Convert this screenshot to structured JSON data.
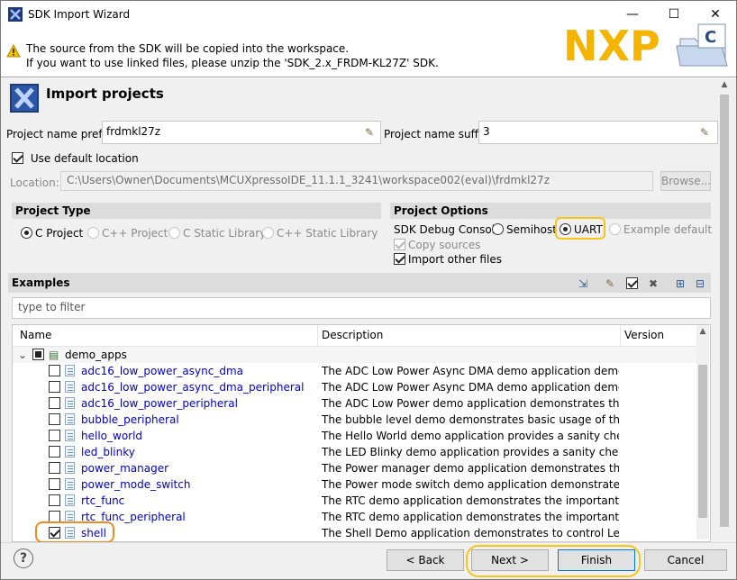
{
  "window": {
    "title": "SDK Import Wizard",
    "min_glyph": "—",
    "max_glyph": "☐",
    "close_glyph": "✕"
  },
  "banner": {
    "line1": "The source from the SDK will be copied into the workspace.",
    "line2": "If you want to use linked files, please unzip the 'SDK_2.x_FRDM-KL27Z' SDK.",
    "logo_text": "NXP",
    "folder_badge": "C"
  },
  "header": {
    "title": "Import projects"
  },
  "project": {
    "prefix_label": "Project name prefix:",
    "prefix_value": "frdmkl27z",
    "suffix_label": "Project name suffix:",
    "suffix_value": "3",
    "use_default_location_label": "Use default location",
    "use_default_location": true,
    "location_label": "Location:",
    "location_value": "C:\\Users\\Owner\\Documents\\MCUXpressoIDE_11.1.1_3241\\workspace002(eval)\\frdmkl27z",
    "browse_label": "Browse..."
  },
  "project_type": {
    "heading": "Project Type",
    "options": [
      "C Project",
      "C++ Project",
      "C Static Library",
      "C++ Static Library"
    ],
    "selected": "C Project"
  },
  "project_options": {
    "heading": "Project Options",
    "debug_console_label": "SDK Debug Console",
    "debug_options": [
      "Semihost",
      "UART",
      "Example default"
    ],
    "selected": "UART",
    "copy_sources_label": "Copy sources",
    "copy_sources": true,
    "import_other_files_label": "Import other files",
    "import_other_files": true
  },
  "examples": {
    "heading": "Examples",
    "filter_placeholder": "type to filter",
    "columns": [
      "Name",
      "Description",
      "Version"
    ],
    "group": "demo_apps",
    "rows": [
      {
        "name": "adc16_low_power_async_dma",
        "desc": "The ADC Low Power Async DMA demo application demonst…",
        "checked": false
      },
      {
        "name": "adc16_low_power_async_dma_peripheral",
        "desc": "The ADC Low Power Async DMA demo application demonst…",
        "checked": false
      },
      {
        "name": "adc16_low_power_peripheral",
        "desc": "The ADC Low Power demo application demonstrates the usa…",
        "checked": false
      },
      {
        "name": "bubble_peripheral",
        "desc": "The bubble level demo demonstrates basic usage of the on-…",
        "checked": false
      },
      {
        "name": "hello_world",
        "desc": "The Hello World demo application provides a sanity check f…",
        "checked": false
      },
      {
        "name": "led_blinky",
        "desc": "The LED Blinky demo application provides a sanity check for…",
        "checked": false
      },
      {
        "name": "power_manager",
        "desc": "The Power manager demo application demonstrates the use…",
        "checked": false
      },
      {
        "name": "power_mode_switch",
        "desc": "The Power mode switch demo application demonstrates the…",
        "checked": false
      },
      {
        "name": "rtc_func",
        "desc": "The RTC demo application demonstrates the important featu…",
        "checked": false
      },
      {
        "name": "rtc_func_peripheral",
        "desc": "The RTC demo application demonstrates the important featu…",
        "checked": false
      },
      {
        "name": "shell",
        "desc": "The Shell Demo application demonstrates to control Leds by…",
        "checked": true
      }
    ]
  },
  "footer": {
    "help_glyph": "?",
    "back_label": "< Back",
    "next_label": "Next >",
    "finish_label": "Finish",
    "cancel_label": "Cancel"
  },
  "colors": {
    "highlight_yellow": "#f5c518",
    "highlight_orange": "#f08a24",
    "link_blue": "#0000cc",
    "group_header_bg": "#dcdcdc"
  }
}
